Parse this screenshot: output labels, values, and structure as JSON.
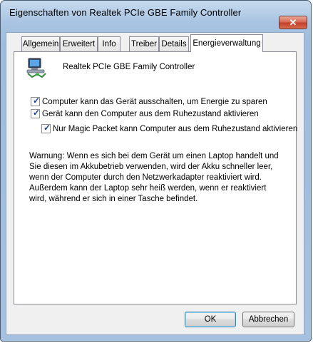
{
  "window": {
    "title": "Eigenschaften von Realtek PCIe GBE Family Controller",
    "close_glyph": "✕"
  },
  "tabs": [
    {
      "label": "Allgemein",
      "active": false
    },
    {
      "label": "Erweitert",
      "active": false
    },
    {
      "label": "Info",
      "active": false
    },
    {
      "label": "Treiber",
      "active": false
    },
    {
      "label": "Details",
      "active": false
    },
    {
      "label": "Energieverwaltung",
      "active": true
    }
  ],
  "device": {
    "icon": "network-adapter-icon",
    "name": "Realtek PCIe GBE Family Controller"
  },
  "options": [
    {
      "label": "Computer kann das Gerät ausschalten, um Energie zu sparen",
      "checked": true
    },
    {
      "label": "Gerät kann den Computer aus dem Ruhezustand aktivieren",
      "checked": true
    },
    {
      "label": "Nur Magic Packet kann Computer aus dem Ruhezustand aktivieren",
      "checked": true
    }
  ],
  "warning": "Warnung: Wenn es sich bei dem Gerät um einen Laptop handelt und Sie diesen im Akkubetrieb verwenden, wird der Akku schneller leer, wenn der Computer durch den Netzwerkadapter reaktiviert wird. Außerdem kann der Laptop sehr heiß werden, wenn er reaktiviert wird, während er sich in einer Tasche befindet.",
  "buttons": {
    "ok": "OK",
    "cancel": "Abbrechen"
  }
}
